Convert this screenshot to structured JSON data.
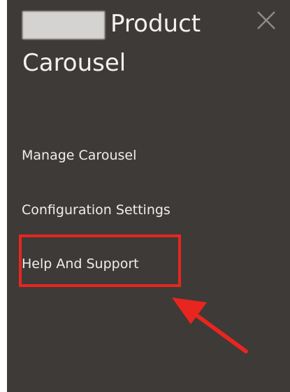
{
  "panel": {
    "title_line1": "Product",
    "title_line2": "Carousel",
    "close_icon": "close-icon"
  },
  "menu": {
    "items": [
      {
        "label": "Manage Carousel"
      },
      {
        "label": "Configuration Settings"
      },
      {
        "label": "Help And Support"
      }
    ]
  },
  "annotation": {
    "highlight_color": "#e8251f",
    "arrow_icon": "arrow-icon"
  },
  "colors": {
    "panel_background": "#3e3a37",
    "text": "#f0eeec"
  }
}
